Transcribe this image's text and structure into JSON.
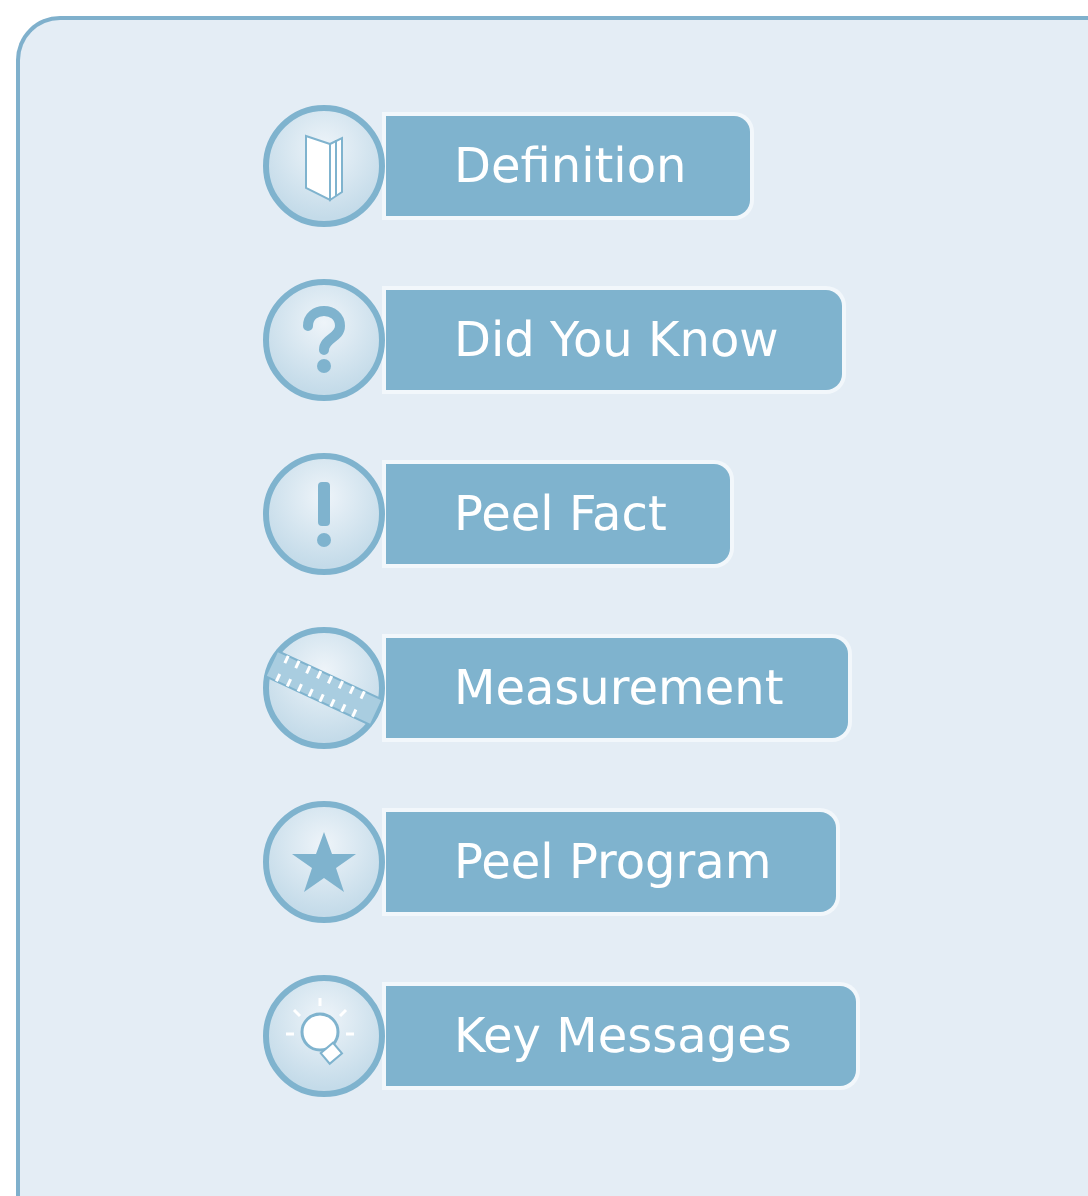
{
  "menu": [
    {
      "label": "Definition",
      "kind": "book"
    },
    {
      "label": "Did You Know",
      "kind": "question"
    },
    {
      "label": "Peel Fact",
      "kind": "exclamation"
    },
    {
      "label": "Measurement",
      "kind": "ruler"
    },
    {
      "label": "Peel Program",
      "kind": "star"
    },
    {
      "label": "Key Messages",
      "kind": "bulb"
    }
  ]
}
